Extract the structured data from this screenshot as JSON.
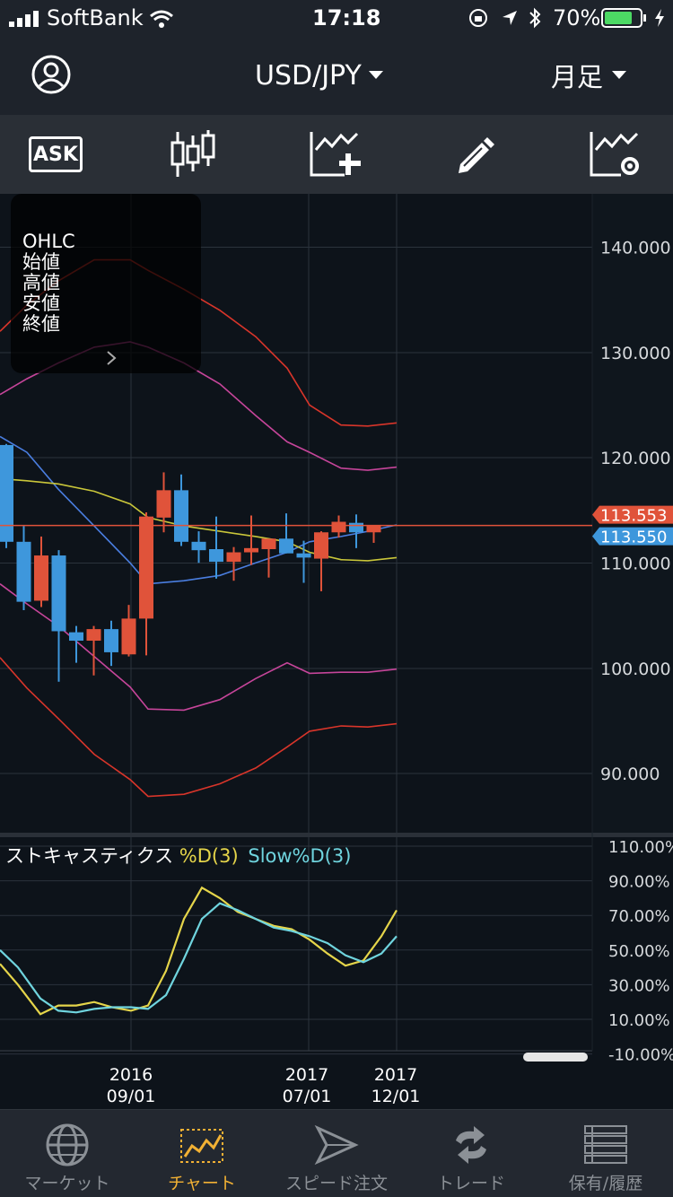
{
  "status": {
    "carrier": "SoftBank",
    "time": "17:18",
    "battery": "70%"
  },
  "header": {
    "pair": "USD/JPY",
    "period": "月足"
  },
  "toolbar": {
    "ask_label": "ASK"
  },
  "ohlc_panel": {
    "lines": [
      "OHLC",
      "始値",
      "高値",
      "安値",
      "終値"
    ]
  },
  "price_axis": {
    "ticks": [
      "140.000",
      "130.000",
      "120.000",
      "110.000",
      "100.000",
      "90.000"
    ],
    "ask_price": "113.553",
    "bid_price": "113.550"
  },
  "oscillator": {
    "name": "ストキャスティクス",
    "d_label": "%D(3)",
    "slowd_label": "Slow%D(3)",
    "ticks": [
      "110.00%",
      "90.00%",
      "70.00%",
      "50.00%",
      "30.00%",
      "10.00%",
      "-10.00%"
    ]
  },
  "time_axis": {
    "labels": [
      {
        "year": "2016",
        "date": "09/01"
      },
      {
        "year": "2017",
        "date": "07/01"
      },
      {
        "year": "2017",
        "date": "12/01"
      }
    ]
  },
  "tabs": [
    {
      "label": "マーケット",
      "icon": "globe-icon"
    },
    {
      "label": "チャート",
      "icon": "chart-icon"
    },
    {
      "label": "スピード注文",
      "icon": "speed-order-icon"
    },
    {
      "label": "トレード",
      "icon": "trade-icon"
    },
    {
      "label": "保有/履歴",
      "icon": "history-icon"
    }
  ],
  "colors": {
    "up": "#e0533a",
    "down": "#3e97dc",
    "bb_outer": "#d8352a",
    "bb_inner": "#c6459a",
    "ma": "#c9c63a",
    "ma_blue": "#4a7ee0",
    "d_line": "#e5d54a",
    "slowd_line": "#6fd4de",
    "accent": "#f2b134"
  },
  "chart_data": {
    "type": "candlestick",
    "xlabel": "",
    "ylabel": "",
    "ylim": [
      86,
      145
    ],
    "x_labels": [
      "2016 09/01",
      "2017 07/01",
      "2017 12/01"
    ],
    "candles": [
      {
        "o": 121.2,
        "h": 121.3,
        "l": 111.4,
        "c": 112.0
      },
      {
        "o": 112.0,
        "h": 113.5,
        "l": 105.5,
        "c": 106.3
      },
      {
        "o": 106.4,
        "h": 112.5,
        "l": 105.8,
        "c": 110.7
      },
      {
        "o": 110.7,
        "h": 111.2,
        "l": 98.7,
        "c": 103.5
      },
      {
        "o": 103.4,
        "h": 104.0,
        "l": 100.5,
        "c": 102.6
      },
      {
        "o": 102.6,
        "h": 104.0,
        "l": 99.3,
        "c": 103.7
      },
      {
        "o": 103.7,
        "h": 104.5,
        "l": 100.2,
        "c": 101.5
      },
      {
        "o": 101.3,
        "h": 106.0,
        "l": 101.1,
        "c": 104.7
      },
      {
        "o": 104.7,
        "h": 114.8,
        "l": 101.2,
        "c": 114.4
      },
      {
        "o": 114.3,
        "h": 118.6,
        "l": 112.9,
        "c": 116.9
      },
      {
        "o": 116.9,
        "h": 118.4,
        "l": 111.6,
        "c": 112.0
      },
      {
        "o": 112.0,
        "h": 113.0,
        "l": 110.0,
        "c": 111.2
      },
      {
        "o": 111.3,
        "h": 114.4,
        "l": 108.5,
        "c": 110.1
      },
      {
        "o": 110.1,
        "h": 111.5,
        "l": 108.3,
        "c": 111.0
      },
      {
        "o": 111.0,
        "h": 114.5,
        "l": 109.8,
        "c": 111.4
      },
      {
        "o": 111.3,
        "h": 112.0,
        "l": 108.6,
        "c": 112.3
      },
      {
        "o": 112.3,
        "h": 114.7,
        "l": 110.9,
        "c": 110.9
      },
      {
        "o": 110.9,
        "h": 112.1,
        "l": 108.1,
        "c": 110.5
      },
      {
        "o": 110.4,
        "h": 113.0,
        "l": 107.3,
        "c": 112.9
      },
      {
        "o": 112.9,
        "h": 114.5,
        "l": 112.4,
        "c": 113.9
      },
      {
        "o": 113.8,
        "h": 114.6,
        "l": 111.4,
        "c": 112.9
      },
      {
        "o": 112.9,
        "h": 113.6,
        "l": 111.9,
        "c": 113.6
      }
    ],
    "bb_upper2": [
      132.0,
      134.5,
      136.8,
      138.8,
      138.8,
      137.8,
      136.0,
      134.0,
      131.5,
      128.5,
      125.0,
      123.1,
      123.0,
      123.3
    ],
    "bb_upper1": [
      126.0,
      127.5,
      129.0,
      130.5,
      131.0,
      130.5,
      129.0,
      127.0,
      124.0,
      121.5,
      120.5,
      119.0,
      118.8,
      119.1
    ],
    "ma_blue_vals": [
      122.0,
      120.5,
      117.0,
      113.5,
      110.0,
      108.0,
      108.3,
      108.8,
      110.0,
      111.0,
      112.0,
      112.5,
      113.0,
      113.6
    ]
  }
}
